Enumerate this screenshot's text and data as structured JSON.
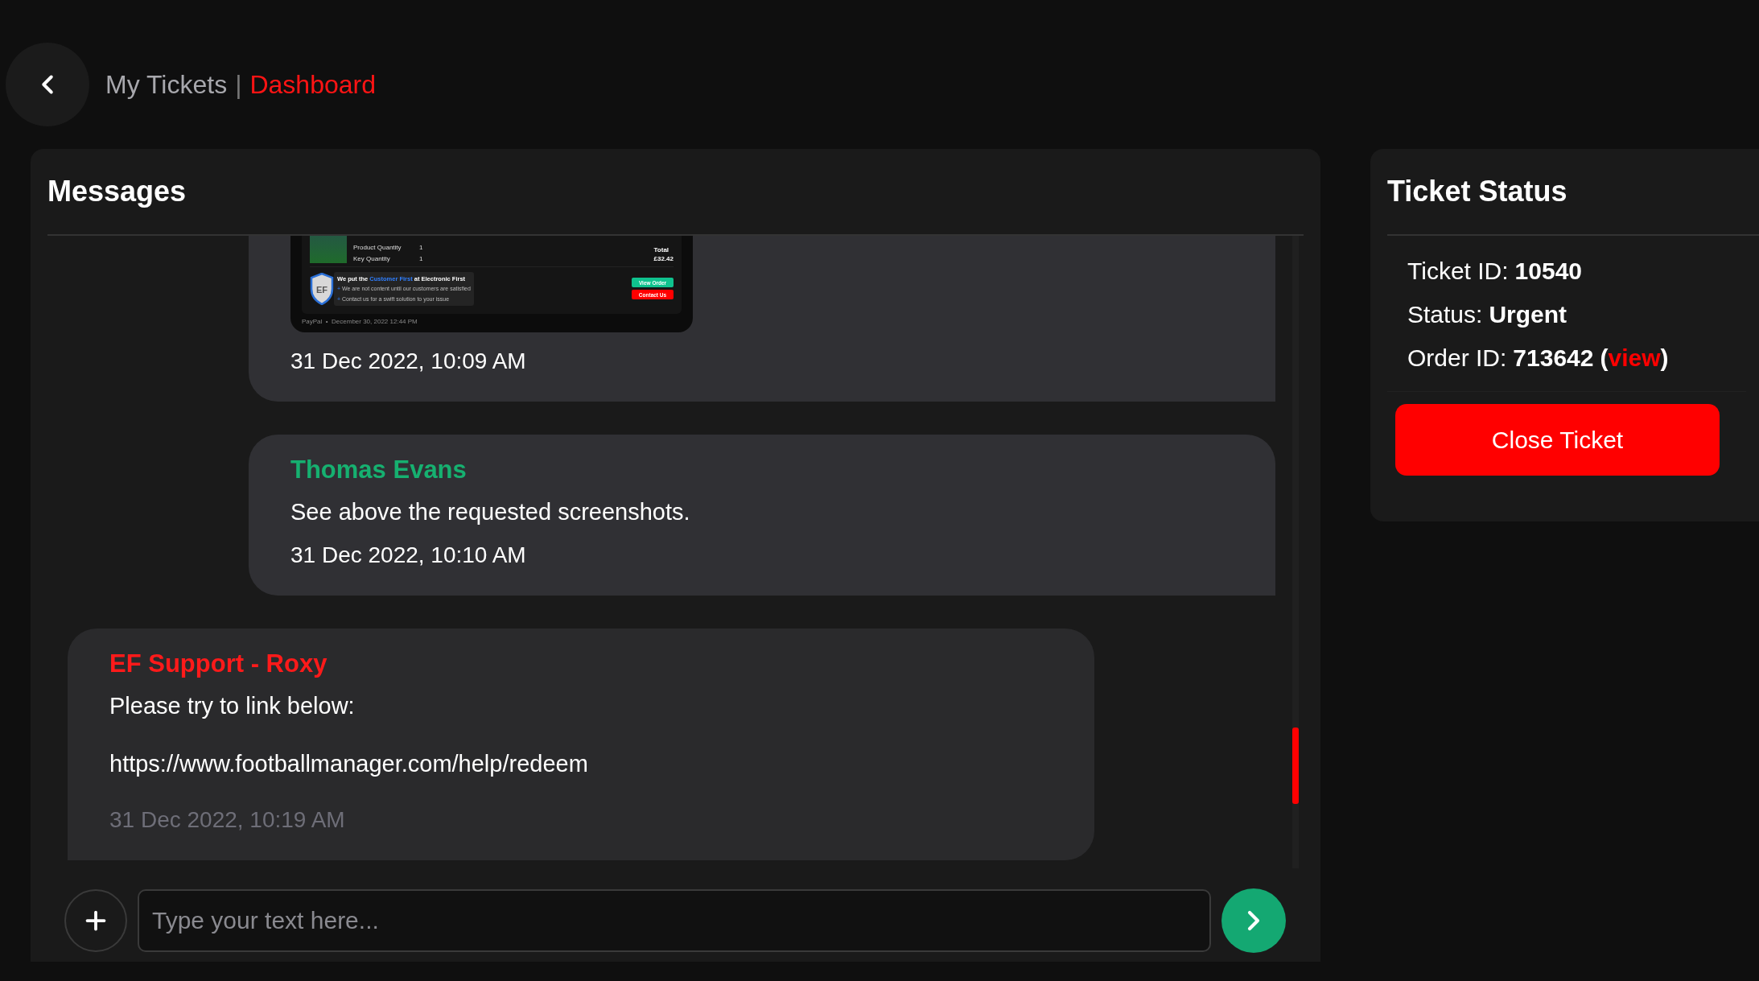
{
  "header": {
    "parent": "My Tickets",
    "separator": "|",
    "current": "Dashboard"
  },
  "messages_panel": {
    "title": "Messages",
    "messages": [
      {
        "kind": "screenshot",
        "time": "31 Dec 2022, 10:09 AM",
        "attachment": {
          "rows": [
            {
              "label": "Product Quantity",
              "value": "1"
            },
            {
              "label": "Key Quantity",
              "value": "1"
            }
          ],
          "total_label": "Total",
          "total": "£32.42",
          "logo": "EF",
          "promo_title": [
            "We put the",
            "Customer First",
            "at Electronic First"
          ],
          "bullet_mark": "+",
          "bullets": [
            "We are not content until our customers are satisfied",
            "Contact us for a swift solution to your issue"
          ],
          "buttons": [
            {
              "label": "View Order",
              "color": "#0fc28e"
            },
            {
              "label": "Contact Us",
              "color": "#ff0000"
            }
          ],
          "footer": "PayPal  •  December 30, 2022 12:44 PM"
        }
      },
      {
        "kind": "customer",
        "sender": "Thomas Evans",
        "lines": [
          "See above the requested screenshots."
        ],
        "time": "31 Dec 2022, 10:10 AM"
      },
      {
        "kind": "agent",
        "sender": "EF Support - Roxy",
        "lines": [
          "Please try to link below:",
          "https://www.footballmanager.com/help/redeem"
        ],
        "time": "31 Dec 2022, 10:19 AM"
      }
    ],
    "composer": {
      "placeholder": "Type your text here..."
    }
  },
  "ticket_status": {
    "title": "Ticket Status",
    "fields": [
      {
        "label": "Ticket ID:",
        "value": "10540"
      },
      {
        "label": "Status:",
        "value": "Urgent"
      },
      {
        "label": "Order ID:",
        "value": "713642",
        "link_before": "(",
        "link": "view",
        "link_after": ")"
      }
    ],
    "close_button": "Close Ticket"
  }
}
